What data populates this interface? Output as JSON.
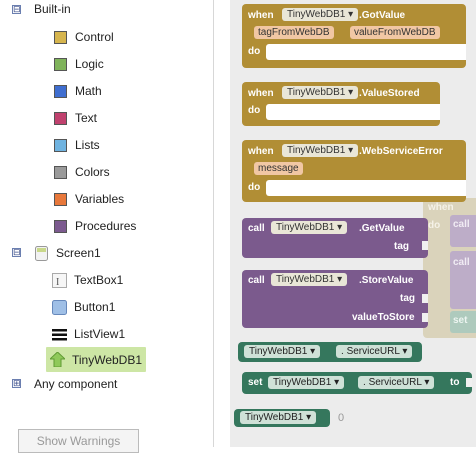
{
  "tree": {
    "builtin_label": "Built-in",
    "builtin_toggle": "⊟",
    "builtins": [
      {
        "label": "Control",
        "color": "#d6b54e"
      },
      {
        "label": "Logic",
        "color": "#7fb35b"
      },
      {
        "label": "Math",
        "color": "#3f6ed0"
      },
      {
        "label": "Text",
        "color": "#c0416e"
      },
      {
        "label": "Lists",
        "color": "#6fb3e0"
      },
      {
        "label": "Colors",
        "color": "#9a9a9a"
      },
      {
        "label": "Variables",
        "color": "#e8783b"
      },
      {
        "label": "Procedures",
        "color": "#7c5a8f"
      }
    ],
    "screen_label": "Screen1",
    "screen_toggle": "⊟",
    "components": [
      {
        "label": "TextBox1",
        "icon": "textbox-icon"
      },
      {
        "label": "Button1",
        "icon": "button-icon"
      },
      {
        "label": "ListView1",
        "icon": "listview-icon"
      },
      {
        "label": "TinyWebDB1",
        "icon": "tinywebdb-icon",
        "selected": true
      }
    ],
    "any_label": "Any component",
    "any_toggle": "⊞"
  },
  "blocks": {
    "when": "when",
    "do": "do",
    "call": "call",
    "set": "set",
    "to": "to",
    "component": "TinyWebDB1",
    "ev1": ".GotValue",
    "ev1_p1": "tagFromWebDB",
    "ev1_p2": "valueFromWebDB",
    "ev2": ".ValueStored",
    "ev3": ".WebServiceError",
    "ev3_p1": "message",
    "m1": ".GetValue",
    "m1_arg": "tag",
    "m2": ".StoreValue",
    "m2_arg1": "tag",
    "m2_arg2": "valueToStore",
    "prop": "ServiceURL",
    "zero": "0",
    "faded_when": "when",
    "faded_do": "do",
    "faded_call": "call",
    "faded_set": "set"
  },
  "warnings_button": "Show Warnings",
  "colors": {
    "event": "#b18e35",
    "method": "#7b5a8d",
    "property": "#35775d"
  }
}
